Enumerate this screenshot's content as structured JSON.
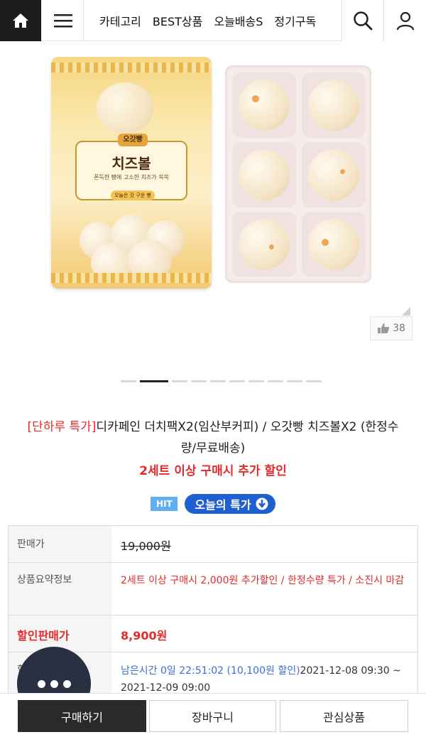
{
  "header": {
    "nav": [
      "카테고리",
      "BEST상품",
      "오늘배송S",
      "정기구독"
    ],
    "icons": {
      "home": "home-icon",
      "menu": "hamburger-menu-icon",
      "search": "search-icon",
      "user": "user-icon"
    }
  },
  "gallery": {
    "bag": {
      "brand": "오갓빵",
      "title": "치즈볼",
      "subtitle": "폰득한 빵에 고소한 치즈가 쏙쏙",
      "pill": "오늘은 갓 구운 빵"
    },
    "likes": "38",
    "pager": {
      "total": 10,
      "active": 1
    }
  },
  "product": {
    "tag": "[단하루 특가]",
    "title": "디카페인 더치팩X2(임산부커피) / 오갓빵 치즈볼X2 (한정수량/무료배송)",
    "promo": "2세트 이상 구매시 추가 할인",
    "badge_hit": "HIT",
    "badge_today": "오늘의 특가"
  },
  "info": {
    "price_label": "판매가",
    "price": "19,000원",
    "summary_label": "상품요약정보",
    "summary": "2세트 이상 구매시 2,000원 추가할인 / 한정수량 특가 / 소진시 마감",
    "sale_label": "할인판매가",
    "sale_price": "8,900원",
    "timer_label": "할",
    "timer_remaining": "남은시간 0일 22:51:02 (10,100원 할인)",
    "timer_period": "2021-12-08 09:30 ~ 2021-12-09 09:00"
  },
  "bottom": {
    "buy": "구매하기",
    "cart": "장바구니",
    "wish": "관심상품"
  },
  "colors": {
    "accent_red": "#e32b2b",
    "badge_blue": "#1f5fd0",
    "hit_blue": "#61aef0",
    "dark": "#2a2a2a"
  }
}
